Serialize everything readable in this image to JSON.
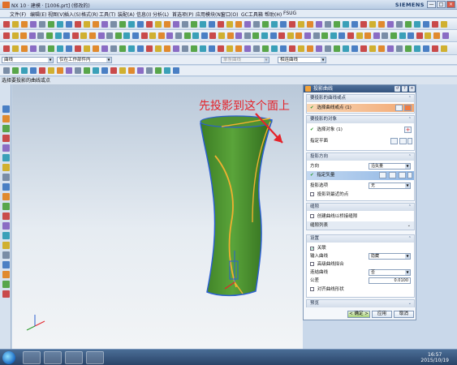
{
  "window": {
    "title": "NX 10 · 建模 · [1006.prt] (修改的)",
    "brand": "SIEMENS",
    "buttons": [
      "—",
      "□",
      "×"
    ]
  },
  "menu": [
    {
      "label": "文件(F)"
    },
    {
      "label": "编辑(E)"
    },
    {
      "label": "视图(V)"
    },
    {
      "label": "插入(S)"
    },
    {
      "label": "格式(R)"
    },
    {
      "label": "工具(T)"
    },
    {
      "label": "装配(A)"
    },
    {
      "label": "信息(I)"
    },
    {
      "label": "分析(L)"
    },
    {
      "label": "首选项(P)"
    },
    {
      "label": "应用模块(N)"
    },
    {
      "label": "窗口(O)"
    },
    {
      "label": "GC工具箱"
    },
    {
      "label": "帮助(H)"
    },
    {
      "label": "FSUG"
    }
  ],
  "selection_bar": {
    "filter_type": "曲线",
    "filter_scope": "仅在工作部件内",
    "filter_mode": "单条曲线",
    "rule": "相连曲线"
  },
  "cue_line": "选择要投影的曲线或点",
  "annotation": "先投影到这个面上",
  "dialog": {
    "title": "投影曲线",
    "group_curves": {
      "header": "要投影的曲线或点",
      "select_label": "选择曲线或点 (1)"
    },
    "group_objects": {
      "header": "要投影的对象",
      "select_label": "选择对象 (1)",
      "plane_label": "指定平面"
    },
    "group_direction": {
      "header": "投影方向",
      "direction_label": "方向",
      "direction_value": "沿矢量",
      "vector_label": "指定矢量",
      "project_option_label": "投影选项",
      "project_option_value": "无",
      "checkbox_label": "投影到最近的点"
    },
    "group_gap": {
      "header": "缝隙",
      "checkbox_label": "创建曲线以桥接缝隙",
      "list_label": "缝隙列表"
    },
    "group_settings": {
      "header": "设置",
      "associative_label": "关联",
      "input_curve_label": "输入曲线",
      "input_curve_value": "隐藏",
      "high_order_label": "高级曲线拟合",
      "join_label": "连结曲线",
      "join_value": "否",
      "tolerance_label": "公差",
      "tolerance_value": "0.0100",
      "align_label": "对齐曲线形状"
    },
    "group_preview": {
      "header": "预览"
    },
    "ok": "< 确定 >",
    "apply": "应用",
    "cancel": "取消"
  },
  "taskbar": {
    "time": "16:57",
    "date": "2015/10/19"
  },
  "colors": {
    "surface": "#3f8a2a",
    "surface_edge": "#2b5fd0",
    "curve": "#f0b030",
    "annotation": "#e4232a"
  }
}
